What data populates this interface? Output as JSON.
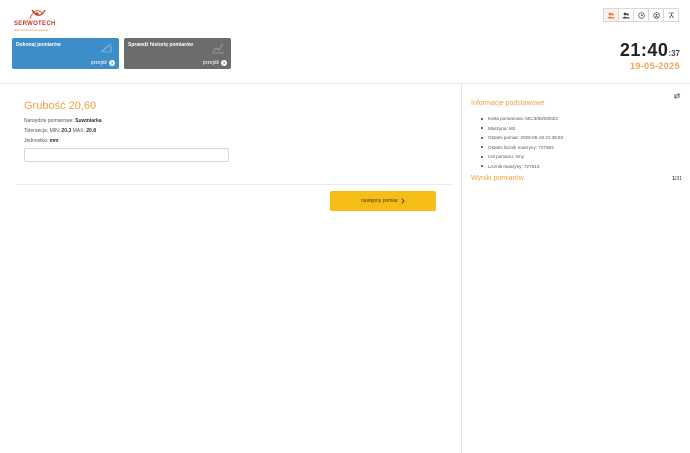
{
  "logo": {
    "brand": "SERWOTECH",
    "tagline": "automatyka przemysłowa"
  },
  "actions": [
    {
      "title": "Dokonaj pomiarów",
      "link": "przejdź"
    },
    {
      "title": "Sprawdź historię pomiarów",
      "link": "przejdź"
    }
  ],
  "clock": {
    "time": "21:40",
    "seconds": ":37",
    "date": "19-05-2025"
  },
  "measurement": {
    "title": "Grubość 20,60",
    "tool_label": "Narzędzie pomiarowe:",
    "tool_value": "Suwmiarka",
    "tolerance_label": "Tolerancja: MIN:",
    "tolerance_min": "20.3",
    "tolerance_max_label": "MAX:",
    "tolerance_max": "20.8",
    "unit_label": "Jednostka:",
    "unit_value": "mm",
    "input_value": "",
    "next_label": "następny pomiar"
  },
  "info": {
    "title": "Informacje podstawowe",
    "items": [
      "Karta pomiarowa: MC/3/80/0003/2",
      "Maszyna: M2",
      "Ostatni pomiar: 2025-05-19 21:38:53",
      "Ostatni licznik maszyny: 727563",
      "Cel pomiaru: Inny",
      "Licznik maszyny: 727613"
    ]
  },
  "results": {
    "title": "Wyniki pomiarów",
    "current": "1",
    "total": "/31"
  },
  "colors": {
    "accent": "#f0a040",
    "primary_card": "#3c8dc8",
    "secondary_card": "#6c6c6c",
    "button": "#f6bd16"
  }
}
